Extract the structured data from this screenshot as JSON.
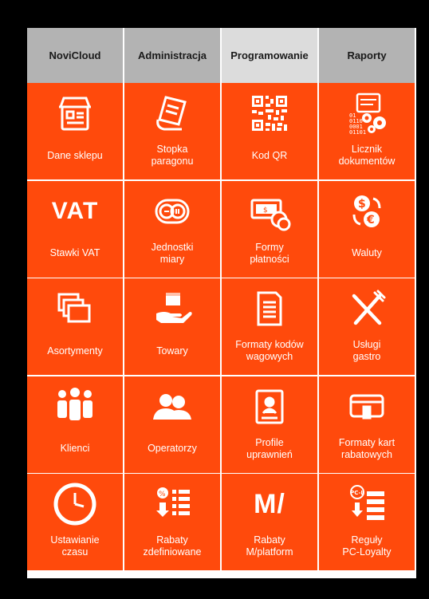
{
  "tabs": [
    {
      "label": "NoviCloud",
      "active": false
    },
    {
      "label": "Administracja",
      "active": false
    },
    {
      "label": "Programowanie",
      "active": true
    },
    {
      "label": "Raporty",
      "active": false
    }
  ],
  "tiles": [
    {
      "label": "Dane sklepu",
      "icon": "shop-icon"
    },
    {
      "label": "Stopka\nparagonu",
      "icon": "receipt-footer-icon"
    },
    {
      "label": "Kod QR",
      "icon": "qr-code-icon"
    },
    {
      "label": "Licznik\ndokumentów",
      "icon": "document-counter-icon"
    },
    {
      "label": "Stawki VAT",
      "icon": "vat-icon",
      "icon_text": "VAT"
    },
    {
      "label": "Jednostki\nmiary",
      "icon": "units-icon"
    },
    {
      "label": "Formy\npłatności",
      "icon": "payment-forms-icon"
    },
    {
      "label": "Waluty",
      "icon": "currencies-icon"
    },
    {
      "label": "Asortymenty",
      "icon": "assortments-icon"
    },
    {
      "label": "Towary",
      "icon": "goods-icon"
    },
    {
      "label": "Formaty kodów\nwagowych",
      "icon": "weight-codes-icon"
    },
    {
      "label": "Usługi\ngastro",
      "icon": "gastro-icon"
    },
    {
      "label": "Klienci",
      "icon": "clients-icon"
    },
    {
      "label": "Operatorzy",
      "icon": "operators-icon"
    },
    {
      "label": "Profile\nuprawnień",
      "icon": "permission-profiles-icon"
    },
    {
      "label": "Formaty kart\nrabatowych",
      "icon": "discount-card-icon"
    },
    {
      "label": "Ustawianie\nczasu",
      "icon": "clock-icon"
    },
    {
      "label": "Rabaty\nzdefiniowane",
      "icon": "defined-discounts-icon"
    },
    {
      "label": "Rabaty\nM/platform",
      "icon": "m-platform-icon",
      "icon_text": "M/"
    },
    {
      "label": "Reguły\nPC-Loyalty",
      "icon": "pc-loyalty-icon",
      "icon_text": "PC-L"
    }
  ],
  "colors": {
    "tile": "#ff4a0c",
    "tab": "#b3b3b3",
    "tab_active": "#dcdcdc"
  }
}
